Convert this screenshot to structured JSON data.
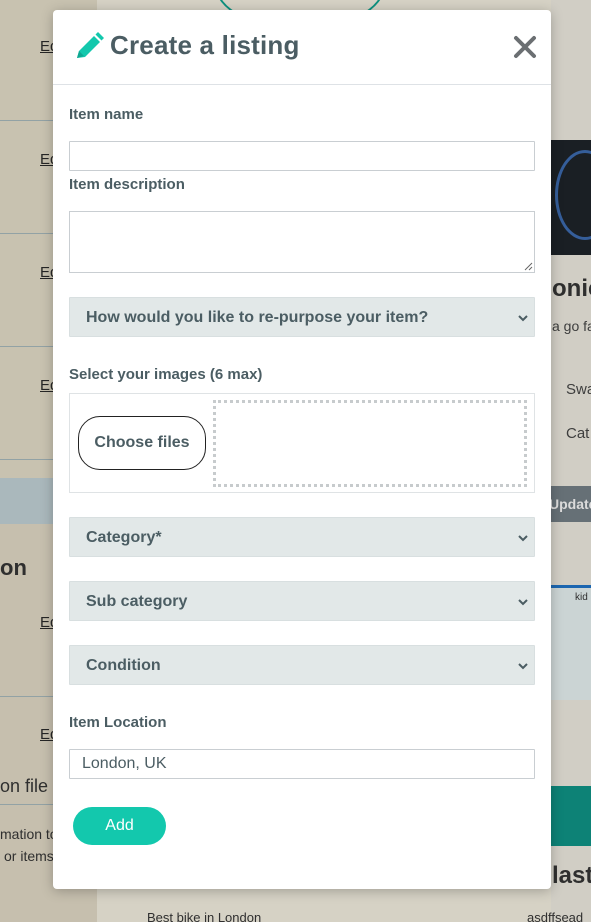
{
  "modal": {
    "title": "Create a listing",
    "title_icon": "pencil-icon",
    "close_icon": "close-icon",
    "accent_color": "#13c8ad"
  },
  "form": {
    "item_name_label": "Item name",
    "item_name_value": "",
    "item_description_label": "Item description",
    "item_description_value": "",
    "repurpose_select": "How would you like to re-purpose your item?",
    "images_label": "Select your images (6 max)",
    "choose_files_label": "Choose files",
    "category_select": "Category*",
    "sub_category_select": "Sub category",
    "condition_select": "Condition",
    "location_label": "Item Location",
    "location_value": "London, UK",
    "add_label": "Add"
  },
  "background": {
    "edit_links": [
      "Ed",
      "Ed",
      "Ed",
      "Ed",
      "Ed",
      "Ed"
    ],
    "heading_fragment": "on",
    "file_fragment": "on file",
    "info_fragment_1": "mation to",
    "info_fragment_2": "or items",
    "right_title_fragment": "onic",
    "right_text_fragment": "a go fa",
    "right_label_1": "Swa",
    "right_label_2": "Cat",
    "update_fragment": "Update",
    "map_fragment": "kid",
    "right_heading_fragment": "last",
    "bottom_left_text": "Best bike in London",
    "bottom_right_text": "asdffsead"
  }
}
